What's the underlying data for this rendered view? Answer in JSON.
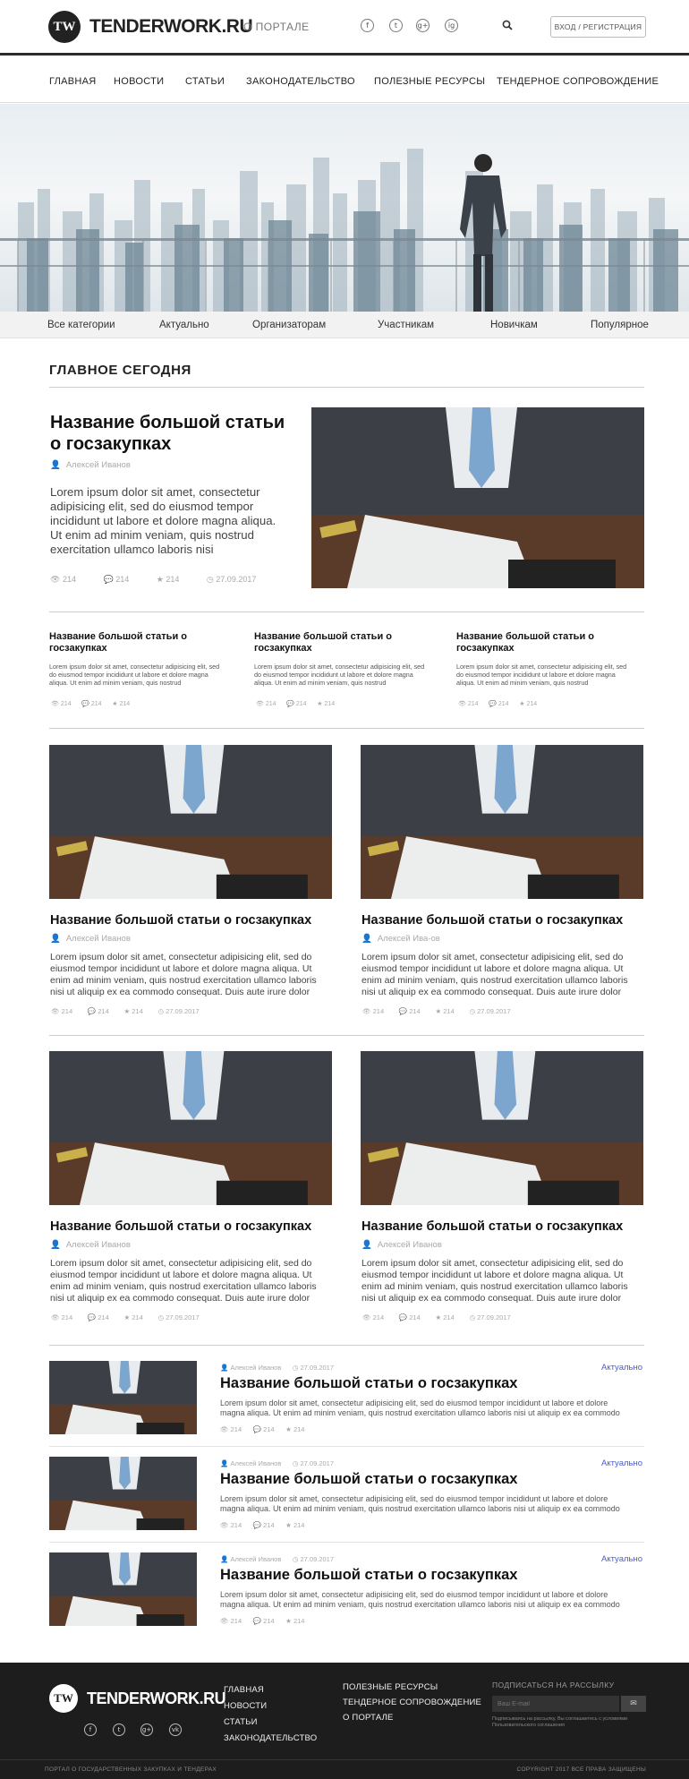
{
  "header": {
    "logo_mark": "TW",
    "logo_text": "TENDERWORK.RU",
    "about": "О ПОРТАЛЕ",
    "social": [
      "f",
      "t",
      "g+",
      "ig"
    ],
    "search_icon": "search-icon",
    "login": "ВХОД / РЕГИСТРАЦИЯ"
  },
  "nav": [
    "ГЛАВНАЯ",
    "НОВОСТИ",
    "СТАТЬИ",
    "ЗАКОНОДАТЕЛЬСТВО",
    "ПОЛЕЗНЫЕ РЕСУРСЫ",
    "ТЕНДЕРНОЕ СОПРОВОЖДЕНИЕ"
  ],
  "categories": [
    "Все категории",
    "Актуально",
    "Организаторам",
    "Участникам",
    "Новичкам",
    "Популярное"
  ],
  "section_title": "ГЛАВНОЕ СЕГОДНЯ",
  "featured": {
    "title": "Название большой статьи о госзакупках",
    "author": "Алексей Иванов",
    "text": "Lorem ipsum dolor sit amet, consectetur adipisicing elit, sed do eiusmod tempor incididunt ut labore et dolore magna aliqua. Ut enim ad minim veniam, quis nostrud exercitation ullamco laboris nisi",
    "views": "214",
    "comments": "214",
    "likes": "214",
    "date": "27.09.2017"
  },
  "small_articles": [
    {
      "title": "Название большой статьи о госзакупках",
      "text": "Lorem ipsum dolor sit amet, consectetur adipisicing elit, sed do eiusmod tempor incididunt ut labore et dolore magna aliqua. Ut enim ad minim veniam, quis nostrud",
      "views": "214",
      "comments": "214",
      "likes": "214"
    },
    {
      "title": "Название большой статьи о госзакупках",
      "text": "Lorem ipsum dolor sit amet, consectetur adipisicing elit, sed do eiusmod tempor incididunt ut labore et dolore magna aliqua. Ut enim ad minim veniam, quis nostrud",
      "views": "214",
      "comments": "214",
      "likes": "214"
    },
    {
      "title": "Название большой статьи о госзакупках",
      "text": "Lorem ipsum dolor sit amet, consectetur adipisicing elit, sed do eiusmod tempor incididunt ut labore et dolore magna aliqua. Ut enim ad minim veniam, quis nostrud",
      "views": "214",
      "comments": "214",
      "likes": "214"
    }
  ],
  "cards": [
    {
      "title": "Название большой статьи о госзакупках",
      "author": "Алексей Иванов",
      "text": "Lorem ipsum dolor sit amet, consectetur adipisicing elit, sed do eiusmod tempor incididunt ut labore et dolore magna aliqua. Ut enim ad minim veniam, quis nostrud exercitation ullamco laboris nisi ut aliquip ex ea commodo consequat. Duis aute irure dolor",
      "views": "214",
      "comments": "214",
      "likes": "214",
      "date": "27.09.2017"
    },
    {
      "title": "Название большой статьи о госзакупках",
      "author": "Алексей Ива-ов",
      "text": "Lorem ipsum dolor sit amet, consectetur adipisicing elit, sed do eiusmod tempor incididunt ut labore et dolore magna aliqua. Ut enim ad minim veniam, quis nostrud exercitation ullamco laboris nisi ut aliquip ex ea commodo consequat. Duis aute irure dolor",
      "views": "214",
      "comments": "214",
      "likes": "214",
      "date": "27.09.2017"
    },
    {
      "title": "Название большой статьи о госзакупках",
      "author": "Алексей Иванов",
      "text": "Lorem ipsum dolor sit amet, consectetur adipisicing elit, sed do eiusmod tempor incididunt ut labore et dolore magna aliqua. Ut enim ad minim veniam, quis nostrud exercitation ullamco laboris nisi ut aliquip ex ea commodo consequat. Duis aute irure dolor",
      "views": "214",
      "comments": "214",
      "likes": "214",
      "date": "27.09.2017"
    },
    {
      "title": "Название большой статьи о госзакупках",
      "author": "Алексей Иванов",
      "text": "Lorem ipsum dolor sit amet, consectetur adipisicing elit, sed do eiusmod tempor incididunt ut labore et dolore magna aliqua. Ut enim ad minim veniam, quis nostrud exercitation ullamco laboris nisi ut aliquip ex ea commodo consequat. Duis aute irure dolor",
      "views": "214",
      "comments": "214",
      "likes": "214",
      "date": "27.09.2017"
    }
  ],
  "list": [
    {
      "author": "Алексей Иванов",
      "date": "27.09.2017",
      "tag": "Актуально",
      "title": "Название большой статьи о госзакупках",
      "text": "Lorem ipsum dolor sit amet, consectetur adipisicing elit, sed do eiusmod tempor incididunt ut labore et dolore magna aliqua. Ut enim ad minim veniam, quis nostrud exercitation ullamco laboris nisi ut aliquip ex ea commodo",
      "views": "214",
      "comments": "214",
      "likes": "214"
    },
    {
      "author": "Алексей Иванов",
      "date": "27.09.2017",
      "tag": "Актуально",
      "title": "Название большой статьи о госзакупках",
      "text": "Lorem ipsum dolor sit amet, consectetur adipisicing elit, sed do eiusmod tempor incididunt ut labore et dolore magna aliqua. Ut enim ad minim veniam, quis nostrud exercitation ullamco laboris nisi ut aliquip ex ea commodo",
      "views": "214",
      "comments": "214",
      "likes": "214"
    },
    {
      "author": "Алексей Иванов",
      "date": "27.09.2017",
      "tag": "Актуально",
      "title": "Название большой статьи о госзакупках",
      "text": "Lorem ipsum dolor sit amet, consectetur adipisicing elit, sed do eiusmod tempor incididunt ut labore et dolore magna aliqua. Ut enim ad minim veniam, quis nostrud exercitation ullamco laboris nisi ut aliquip ex ea commodo",
      "views": "214",
      "comments": "214",
      "likes": "214"
    }
  ],
  "footer": {
    "logo_mark": "TW",
    "logo_text": "TENDERWORK.RU",
    "social": [
      "f",
      "t",
      "g+",
      "vk"
    ],
    "col1": [
      "ГЛАВНАЯ",
      "НОВОСТИ",
      "СТАТЬИ",
      "ЗАКОНОДАТЕЛЬСТВО"
    ],
    "col2": [
      "ПОЛЕЗНЫЕ РЕСУРСЫ",
      "ТЕНДЕРНОЕ СОПРОВОЖДЕНИЕ",
      "О ПОРТАЛЕ"
    ],
    "subscribe": "ПОДПИСАТЬСЯ НА РАССЫЛКУ",
    "email_placeholder": "Ваш E-mail",
    "note": "Подписываясь на рассылку, Вы соглашаетесь с условиями Пользовательского соглашения",
    "bottom_left": "ПОРТАЛ О ГОСУДАРСТВЕННЫХ ЗАКУПКАХ И ТЕНДЕРАХ",
    "bottom_right": "COPYRIGHT 2017 ВСЕ ПРАВА ЗАЩИЩЕНЫ"
  },
  "colors": {
    "accent_link": "#4a5bd0",
    "footer_bg": "#1d1d1d",
    "rule": "#cccccc"
  }
}
